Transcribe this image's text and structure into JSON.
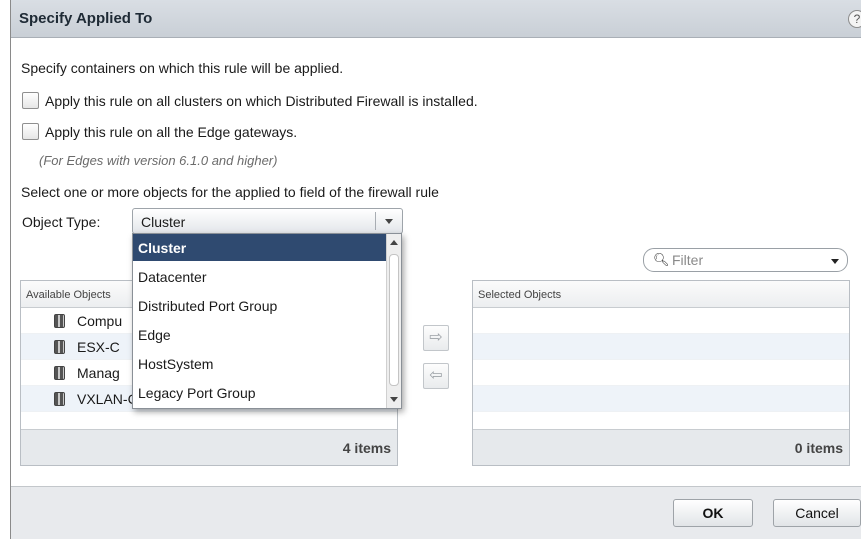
{
  "dialog": {
    "title": "Specify Applied To",
    "help_label": "?",
    "intro": "Specify containers on which this rule will be applied.",
    "option_all_clusters": "Apply this rule on all clusters on which Distributed Firewall is installed.",
    "option_all_edges": "Apply this rule on all the Edge gateways.",
    "edge_note": "(For Edges with version 6.1.0 and higher)",
    "select_instruction": "Select one or more objects for the applied to field of the firewall rule",
    "object_type_label": "Object Type:",
    "object_type_value": "Cluster",
    "object_type_options": [
      "Cluster",
      "Datacenter",
      "Distributed Port Group",
      "Edge",
      "HostSystem",
      "Legacy Port Group"
    ],
    "filter_placeholder": "Filter",
    "available": {
      "header": "Available Objects",
      "items": [
        "Compu",
        "ESX-C",
        "Manag",
        "VXLAN-COMPUTE-1"
      ],
      "count": "4 items"
    },
    "selected": {
      "header": "Selected Objects",
      "items": [],
      "count": "0 items"
    },
    "ok_label": "OK",
    "cancel_label": "Cancel"
  },
  "icons": {
    "help": "help-icon",
    "search": "search-icon",
    "move_right": "arrow-right-icon",
    "move_left": "arrow-left-icon",
    "cluster": "cluster-icon"
  }
}
